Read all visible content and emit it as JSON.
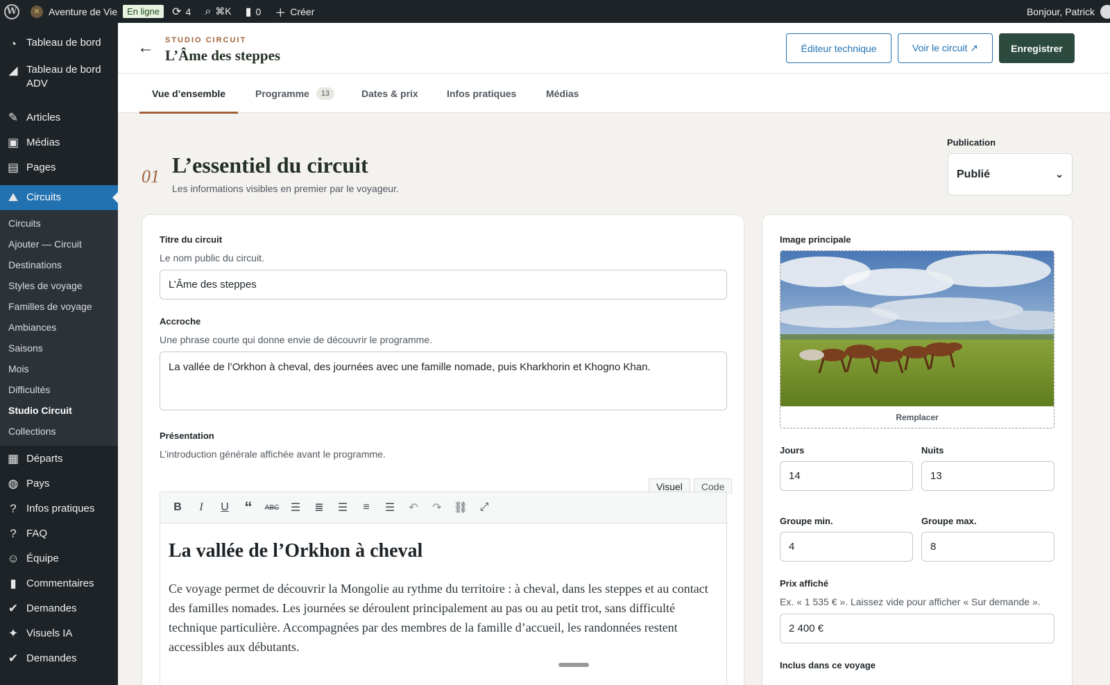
{
  "adminbar": {
    "site_name": "Aventure de Vie",
    "status_badge": "En ligne",
    "updates_count": "4",
    "search_shortcut": "⌘K",
    "comments_count": "0",
    "create_label": "Créer",
    "greeting": "Bonjour, Patrick"
  },
  "sidebar": {
    "items_top": [
      {
        "label": "Tableau de bord",
        "icon": "dashboard-icon"
      },
      {
        "label": "Tableau de bord ADV",
        "icon": "chart-icon"
      },
      {
        "label": "Articles",
        "icon": "pin-icon"
      },
      {
        "label": "Médias",
        "icon": "media-icon"
      },
      {
        "label": "Pages",
        "icon": "pages-icon"
      },
      {
        "label": "Circuits",
        "icon": "map-icon"
      }
    ],
    "submenu": [
      "Circuits",
      "Ajouter — Circuit",
      "Destinations",
      "Styles de voyage",
      "Familles de voyage",
      "Ambiances",
      "Saisons",
      "Mois",
      "Difficultés",
      "Studio Circuit",
      "Collections"
    ],
    "items_bottom": [
      {
        "label": "Départs",
        "icon": "calendar-icon"
      },
      {
        "label": "Pays",
        "icon": "globe-icon"
      },
      {
        "label": "Infos pratiques",
        "icon": "help-icon"
      },
      {
        "label": "FAQ",
        "icon": "help-icon"
      },
      {
        "label": "Équipe",
        "icon": "team-icon"
      },
      {
        "label": "Commentaires",
        "icon": "comment-icon"
      },
      {
        "label": "Demandes",
        "icon": "check-icon"
      },
      {
        "label": "Visuels IA",
        "icon": "ai-icon"
      },
      {
        "label": "Demandes",
        "icon": "check-icon"
      }
    ]
  },
  "header": {
    "eyebrow": "STUDIO CIRCUIT",
    "title": "L’Âme des steppes",
    "btn_tech": "Éditeur technique",
    "btn_view": "Voir le circuit ↗",
    "btn_save": "Enregistrer"
  },
  "tabs": {
    "overview": "Vue d’ensemble",
    "programme": "Programme",
    "programme_count": "13",
    "dates": "Dates & prix",
    "infos": "Infos pratiques",
    "medias": "Médias"
  },
  "section": {
    "number": "01",
    "title": "L’essentiel du circuit",
    "subtitle": "Les informations visibles en premier par le voyageur."
  },
  "publication": {
    "label": "Publication",
    "value": "Publié"
  },
  "form": {
    "title_label": "Titre du circuit",
    "title_help": "Le nom public du circuit.",
    "title_value": "L’Âme des steppes",
    "hook_label": "Accroche",
    "hook_help": "Une phrase courte qui donne envie de découvrir le programme.",
    "hook_value": "La vallée de l’Orkhon à cheval, des journées avec une famille nomade, puis Kharkhorin et Khogno Khan.",
    "presentation_label": "Présentation",
    "presentation_help": "L’introduction générale affichée avant le programme.",
    "editor_tab_visual": "Visuel",
    "editor_tab_code": "Code",
    "editor_heading": "La vallée de l’Orkhon à cheval",
    "editor_paragraph": "Ce voyage permet de découvrir la Mongolie au rythme du territoire : à cheval, dans les steppes et au contact des familles nomades. Les journées se déroulent principalement au pas ou au petit trot, sans difficulté technique particulière. Accompagnées par des membres de la famille d’accueil, les randonnées restent accessibles aux débutants."
  },
  "side": {
    "image_label": "Image principale",
    "replace_label": "Remplacer",
    "days_label": "Jours",
    "days_value": "14",
    "nights_label": "Nuits",
    "nights_value": "13",
    "group_min_label": "Groupe min.",
    "group_min_value": "4",
    "group_max_label": "Groupe max.",
    "group_max_value": "8",
    "price_label": "Prix affiché",
    "price_help": "Ex. « 1 535 € ». Laissez vide pour afficher « Sur demande ».",
    "price_value": "2 400 €",
    "included_label": "Inclus dans ce voyage"
  }
}
